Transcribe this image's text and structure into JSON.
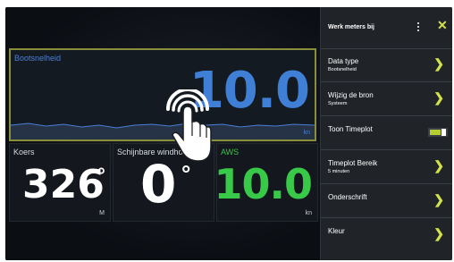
{
  "tiles": {
    "speed": {
      "label": "Bootsnelheid",
      "value": "10.0",
      "unit": "kn"
    },
    "heading": {
      "label": "Koers",
      "value": "326",
      "degree": "°",
      "unit": "M"
    },
    "wind_angle": {
      "label": "Schijnbare windhoek",
      "value": "0",
      "degree": "°"
    },
    "aws": {
      "label": "AWS",
      "value": "10.0",
      "unit": "kn"
    }
  },
  "panel": {
    "title": "Werk meters bij",
    "close": "✕",
    "items": [
      {
        "label": "Data type",
        "sub": "Bootsnelheid",
        "chevron": "❯"
      },
      {
        "label": "Wijzig de bron",
        "sub": "Systeem",
        "chevron": "❯"
      },
      {
        "label": "Toon Timeplot",
        "toggle_on": true
      },
      {
        "label": "Timeplot Bereik",
        "sub": "5 minuten",
        "chevron": "❯"
      },
      {
        "label": "Onderschrift",
        "chevron": "❯"
      },
      {
        "label": "Kleur",
        "chevron": "❯"
      }
    ]
  },
  "colors": {
    "accent": "#d4e24a",
    "speed": "#3f7fd6",
    "aws": "#38c948",
    "highlight_border": "#8a8d3a"
  },
  "icons": {
    "gesture": "tap-hand-icon",
    "menu": "kebab-menu-icon",
    "close": "close-icon",
    "chevron": "chevron-right-icon"
  }
}
